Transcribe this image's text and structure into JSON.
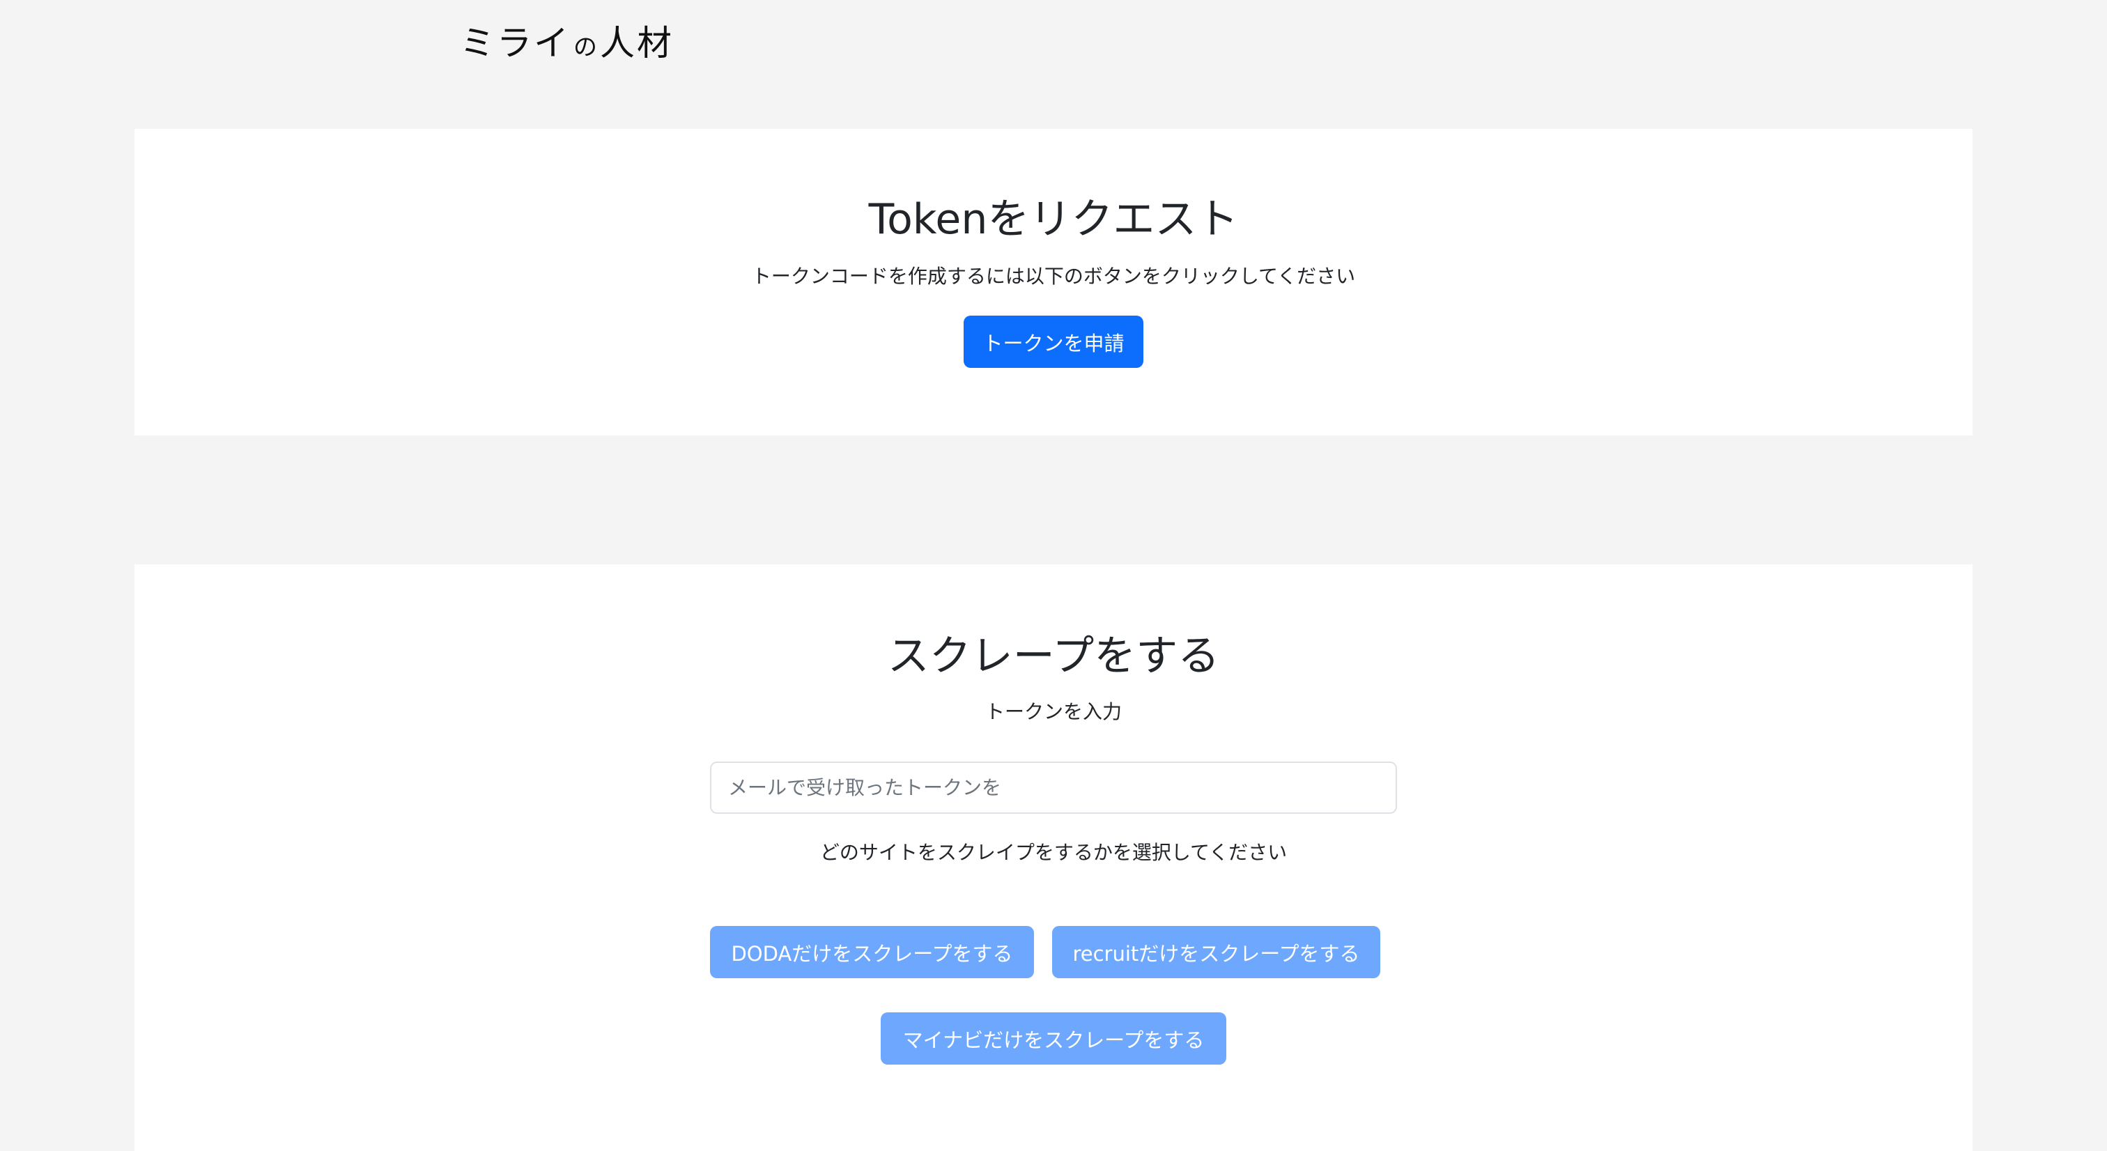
{
  "brand": {
    "part1": "ミライ",
    "part2": "の",
    "part3": "人材"
  },
  "token_section": {
    "title": "Tokenをリクエスト",
    "description": "トークンコードを作成するには以下のボタンをクリックしてください",
    "request_button": "トークンを申請"
  },
  "scrape_section": {
    "title": "スクレープをする",
    "input_label": "トークンを入力",
    "token_input": {
      "placeholder": "メールで受け取ったトークンを",
      "value": ""
    },
    "site_prompt": "どのサイトをスクレイプをするかを選択してください",
    "buttons": {
      "doda": "DODAだけをスクレープをする",
      "recruit": "recruitだけをスクレープをする",
      "mynavi": "マイナビだけをスクレープをする"
    }
  },
  "colors": {
    "page_background": "#f4f4f4",
    "card_background": "#ffffff",
    "primary": "#0d6efd",
    "primary_disabled": "#6ea8fe"
  }
}
